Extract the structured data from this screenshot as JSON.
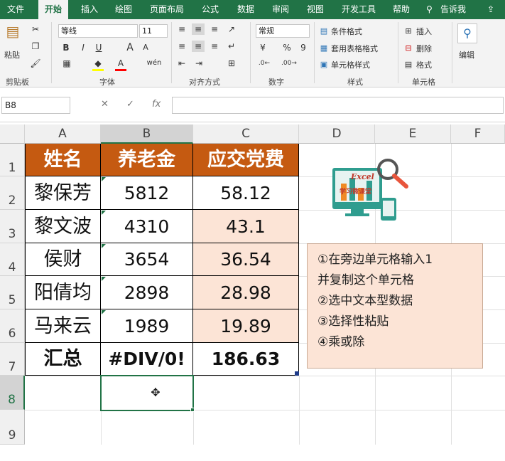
{
  "menu": {
    "file": "文件",
    "home": "开始",
    "insert": "插入",
    "draw": "绘图",
    "layout": "页面布局",
    "formulas": "公式",
    "data": "数据",
    "review": "审阅",
    "view": "视图",
    "developer": "开发工具",
    "help": "帮助",
    "tell_me": "告诉我"
  },
  "ribbon": {
    "paste": "粘贴",
    "clipboard": "剪贴板",
    "font_name": "等线",
    "font_size": "11",
    "font_group": "字体",
    "bold": "B",
    "italic": "I",
    "underline": "U",
    "grow_font": "A",
    "shrink_font": "A",
    "phonetic": "wén",
    "alignment_group": "对齐方式",
    "number_format": "常规",
    "number_group": "数字",
    "currency": "¥",
    "percent": "%",
    "comma": "9",
    "cond_format": "条件格式",
    "table_format": "套用表格格式",
    "cell_style": "单元格样式",
    "styles_group": "样式",
    "insert_cells": "插入",
    "delete_cells": "删除",
    "format_cells": "格式",
    "cells_group": "单元格",
    "editing": "编辑"
  },
  "formula_bar": {
    "name_box": "B8",
    "cancel": "✕",
    "enter": "✓",
    "fx": "fx",
    "content": ""
  },
  "columns": [
    "A",
    "B",
    "C",
    "D",
    "E",
    "F"
  ],
  "rows": [
    "1",
    "2",
    "3",
    "4",
    "5",
    "6",
    "7",
    "8",
    "9"
  ],
  "table": {
    "headers": [
      "姓名",
      "养老金",
      "应交党费"
    ],
    "rows": [
      [
        "黎保芳",
        "5812",
        "58.12"
      ],
      [
        "黎文波",
        "4310",
        "43.1"
      ],
      [
        "侯财",
        "3654",
        "36.54"
      ],
      [
        "阳倩均",
        "2898",
        "28.98"
      ],
      [
        "马来云",
        "1989",
        "19.89"
      ]
    ],
    "total": [
      "汇总",
      "#DIV/0!",
      "186.63"
    ]
  },
  "logo_text": "Excel",
  "logo_sub": "学习微课堂",
  "note": {
    "line1": "①在旁边单元格输入1",
    "line2": "并复制这个单元格",
    "line3": "②选中文本型数据",
    "line4": "③选择性粘贴",
    "line5": "④乘或除"
  },
  "colors": {
    "brand": "#217346",
    "header_fill": "#c55a11",
    "highlight_fill": "#fce4d6"
  },
  "icons": [
    "search-icon",
    "share-icon",
    "cut-icon",
    "copy-icon",
    "format-painter-icon",
    "fill-color-icon",
    "font-color-icon",
    "magnifier-icon",
    "cross-cursor-icon"
  ]
}
